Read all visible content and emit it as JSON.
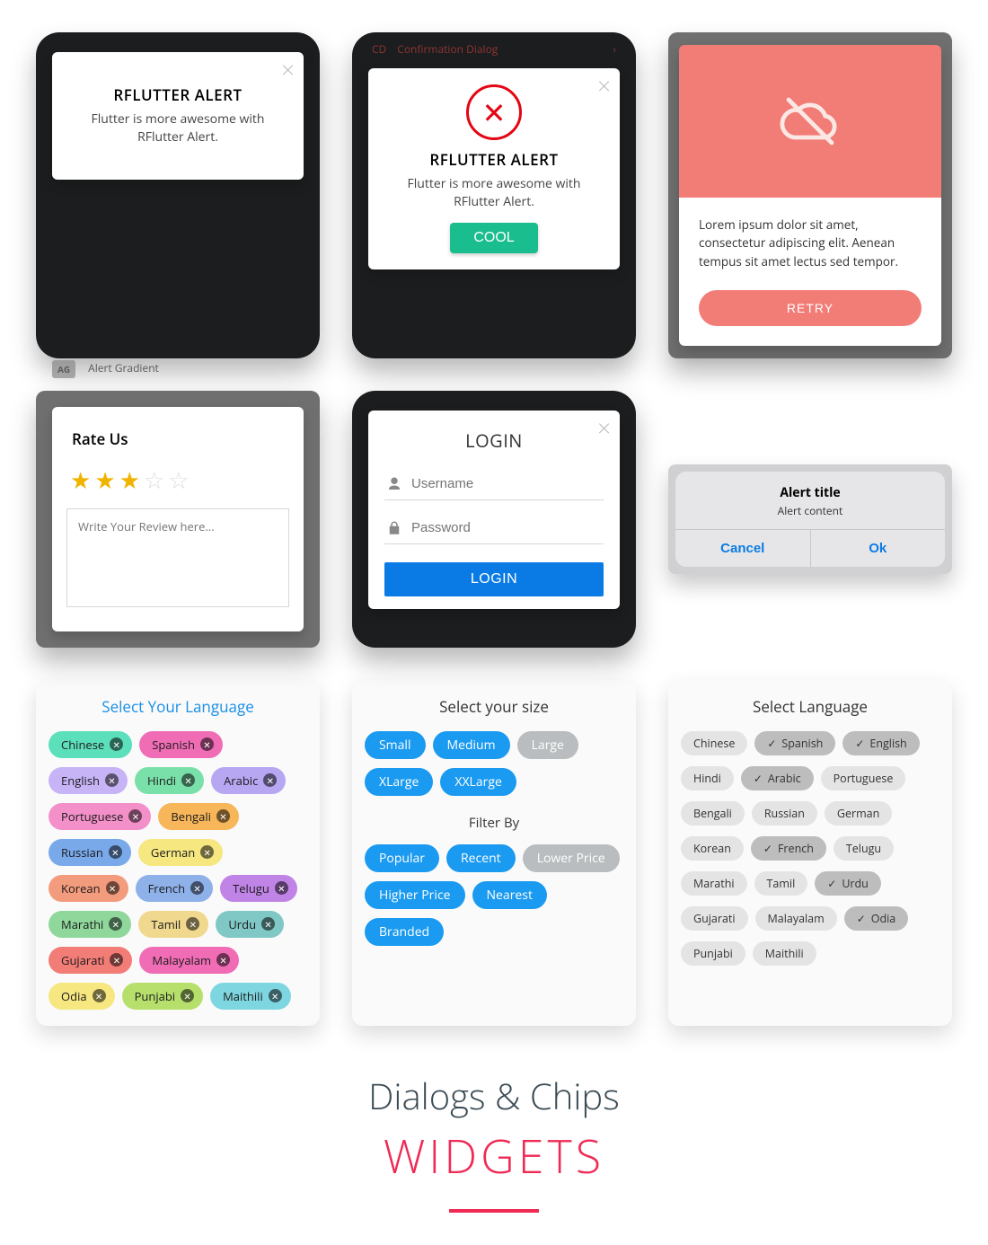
{
  "alert1": {
    "title": "RFLUTTER ALERT",
    "body": "Flutter is more awesome with RFlutter Alert."
  },
  "alert2": {
    "title": "RFLUTTER ALERT",
    "body": "Flutter is more awesome with RFlutter Alert.",
    "button": "COOL"
  },
  "cloud": {
    "body": "Lorem ipsum dolor sit amet, consectetur adipiscing elit. Aenean tempus sit amet lectus sed tempor.",
    "retry": "RETRY"
  },
  "rate": {
    "title": "Rate Us",
    "stars_filled": 3,
    "placeholder": "Write Your Review here..."
  },
  "login": {
    "title": "LOGIN",
    "user_ph": "Username",
    "pass_ph": "Password",
    "button": "LOGIN"
  },
  "ios": {
    "title": "Alert title",
    "content": "Alert content",
    "cancel": "Cancel",
    "ok": "Ok"
  },
  "behind_row": {
    "tag": "AG",
    "text": "Alert Gradient"
  },
  "behind_top": {
    "tag": "CD",
    "text": "Confirmation Dialog"
  },
  "chips_lang": {
    "title": "Select Your Language",
    "items": [
      {
        "label": "Chinese",
        "bg": "#5ce0bb"
      },
      {
        "label": "Spanish",
        "bg": "#f06db6"
      },
      {
        "label": "English",
        "bg": "#c6b4f6"
      },
      {
        "label": "Hindi",
        "bg": "#7ae0a9"
      },
      {
        "label": "Arabic",
        "bg": "#b7a6f2"
      },
      {
        "label": "Portuguese",
        "bg": "#f390c9"
      },
      {
        "label": "Bengali",
        "bg": "#f7b65a"
      },
      {
        "label": "Russian",
        "bg": "#7aa9ea"
      },
      {
        "label": "German",
        "bg": "#f6e781"
      },
      {
        "label": "Korean",
        "bg": "#f39b7d"
      },
      {
        "label": "French",
        "bg": "#8fb1ea"
      },
      {
        "label": "Telugu",
        "bg": "#c084e6"
      },
      {
        "label": "Marathi",
        "bg": "#8fd79b"
      },
      {
        "label": "Tamil",
        "bg": "#f0d88e"
      },
      {
        "label": "Urdu",
        "bg": "#7fc8c5"
      },
      {
        "label": "Gujarati",
        "bg": "#f27c76"
      },
      {
        "label": "Malayalam",
        "bg": "#f06db6"
      },
      {
        "label": "Odia",
        "bg": "#f6e781"
      },
      {
        "label": "Punjabi",
        "bg": "#b6e06b"
      },
      {
        "label": "Maithili",
        "bg": "#7ed6e0"
      }
    ]
  },
  "chips_size": {
    "title": "Select your size",
    "sizes": [
      {
        "label": "Small",
        "sel": true
      },
      {
        "label": "Medium",
        "sel": true
      },
      {
        "label": "Large",
        "sel": false
      },
      {
        "label": "XLarge",
        "sel": true
      },
      {
        "label": "XXLarge",
        "sel": true
      }
    ],
    "filter_title": "Filter By",
    "filters": [
      {
        "label": "Popular",
        "sel": true
      },
      {
        "label": "Recent",
        "sel": true
      },
      {
        "label": "Lower Price",
        "sel": false
      },
      {
        "label": "Higher Price",
        "sel": true
      },
      {
        "label": "Nearest",
        "sel": true
      },
      {
        "label": "Branded",
        "sel": true
      }
    ]
  },
  "chips_sel_lang": {
    "title": "Select Language",
    "items": [
      {
        "label": "Chinese",
        "sel": false
      },
      {
        "label": "Spanish",
        "sel": true
      },
      {
        "label": "English",
        "sel": true
      },
      {
        "label": "Hindi",
        "sel": false
      },
      {
        "label": "Arabic",
        "sel": true
      },
      {
        "label": "Portuguese",
        "sel": false
      },
      {
        "label": "Bengali",
        "sel": false
      },
      {
        "label": "Russian",
        "sel": false
      },
      {
        "label": "German",
        "sel": false
      },
      {
        "label": "Korean",
        "sel": false
      },
      {
        "label": "French",
        "sel": true
      },
      {
        "label": "Telugu",
        "sel": false
      },
      {
        "label": "Marathi",
        "sel": false
      },
      {
        "label": "Tamil",
        "sel": false
      },
      {
        "label": "Urdu",
        "sel": true
      },
      {
        "label": "Gujarati",
        "sel": false
      },
      {
        "label": "Malayalam",
        "sel": false
      },
      {
        "label": "Odia",
        "sel": true
      },
      {
        "label": "Punjabi",
        "sel": false
      },
      {
        "label": "Maithili",
        "sel": false
      }
    ]
  },
  "footer": {
    "line1": "Dialogs & Chips",
    "line2": "WIDGETS"
  }
}
